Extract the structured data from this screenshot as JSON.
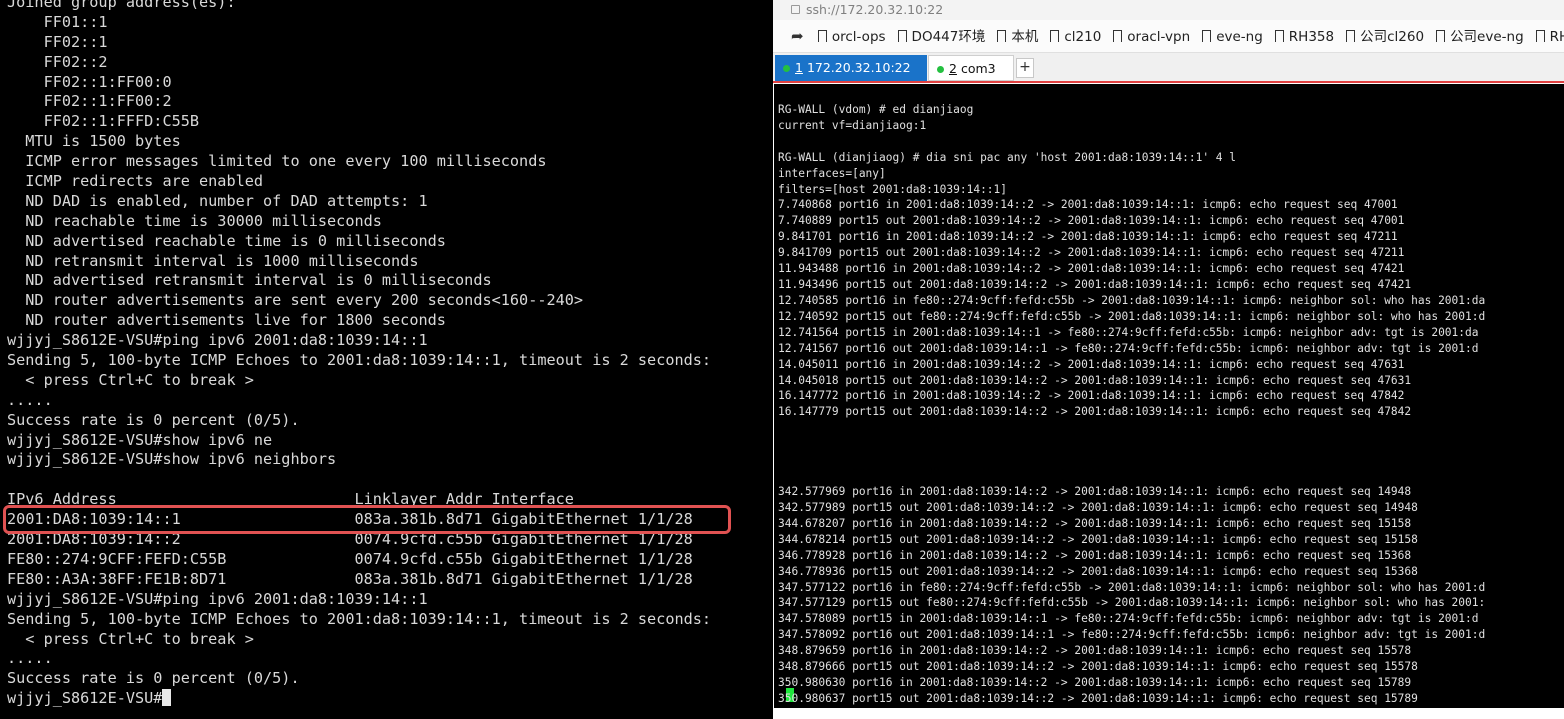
{
  "left_terminal": {
    "lines": [
      "Joined group address(es):",
      "    FF01::1",
      "    FF02::1",
      "    FF02::2",
      "    FF02::1:FF00:0",
      "    FF02::1:FF00:2",
      "    FF02::1:FFFD:C55B",
      "  MTU is 1500 bytes",
      "  ICMP error messages limited to one every 100 milliseconds",
      "  ICMP redirects are enabled",
      "  ND DAD is enabled, number of DAD attempts: 1",
      "  ND reachable time is 30000 milliseconds",
      "  ND advertised reachable time is 0 milliseconds",
      "  ND retransmit interval is 1000 milliseconds",
      "  ND advertised retransmit interval is 0 milliseconds",
      "  ND router advertisements are sent every 200 seconds<160--240>",
      "  ND router advertisements live for 1800 seconds",
      "wjjyj_S8612E-VSU#ping ipv6 2001:da8:1039:14::1",
      "Sending 5, 100-byte ICMP Echoes to 2001:da8:1039:14::1, timeout is 2 seconds:",
      "  < press Ctrl+C to break >",
      ".....",
      "Success rate is 0 percent (0/5).",
      "wjjyj_S8612E-VSU#show ipv6 ne",
      "wjjyj_S8612E-VSU#show ipv6 neighbors",
      "",
      "IPv6 Address                          Linklayer Addr Interface",
      "2001:DA8:1039:14::1                   083a.381b.8d71 GigabitEthernet 1/1/28",
      "2001:DA8:1039:14::2                   0074.9cfd.c55b GigabitEthernet 1/1/28",
      "FE80::274:9CFF:FEFD:C55B              0074.9cfd.c55b GigabitEthernet 1/1/28",
      "FE80::A3A:38FF:FE1B:8D71              083a.381b.8d71 GigabitEthernet 1/1/28",
      "wjjyj_S8612E-VSU#ping ipv6 2001:da8:1039:14::1",
      "Sending 5, 100-byte ICMP Echoes to 2001:da8:1039:14::1, timeout is 2 seconds:",
      "  < press Ctrl+C to break >",
      ".....",
      "Success rate is 0 percent (0/5)."
    ],
    "prompt": "wjjyj_S8612E-VSU#"
  },
  "browser": {
    "url": "ssh://172.20.32.10:22",
    "bookmarks": [
      "orcl-ops",
      "DO447环境",
      "本机",
      "cl210",
      "oracl-vpn",
      "eve-ng",
      "RH358",
      "公司cl260",
      "公司eve-ng",
      "RH"
    ],
    "tabs": [
      {
        "num": "1",
        "label": "172.20.32.10:22",
        "status_color": "#24c040"
      },
      {
        "num": "2",
        "label": "com3",
        "status_color": "#24c040"
      }
    ],
    "add_tab_label": "+"
  },
  "right_terminal": {
    "lines": [
      "",
      "RG-WALL (vdom) # ed dianjiaog",
      "current vf=dianjiaog:1",
      "",
      "RG-WALL (dianjiaog) # dia sni pac any 'host 2001:da8:1039:14::1' 4 l",
      "interfaces=[any]",
      "filters=[host 2001:da8:1039:14::1]",
      "7.740868 port16 in 2001:da8:1039:14::2 -> 2001:da8:1039:14::1: icmp6: echo request seq 47001",
      "7.740889 port15 out 2001:da8:1039:14::2 -> 2001:da8:1039:14::1: icmp6: echo request seq 47001",
      "9.841701 port16 in 2001:da8:1039:14::2 -> 2001:da8:1039:14::1: icmp6: echo request seq 47211",
      "9.841709 port15 out 2001:da8:1039:14::2 -> 2001:da8:1039:14::1: icmp6: echo request seq 47211",
      "11.943488 port16 in 2001:da8:1039:14::2 -> 2001:da8:1039:14::1: icmp6: echo request seq 47421",
      "11.943496 port15 out 2001:da8:1039:14::2 -> 2001:da8:1039:14::1: icmp6: echo request seq 47421",
      "12.740585 port16 in fe80::274:9cff:fefd:c55b -> 2001:da8:1039:14::1: icmp6: neighbor sol: who has 2001:da",
      "12.740592 port15 out fe80::274:9cff:fefd:c55b -> 2001:da8:1039:14::1: icmp6: neighbor sol: who has 2001:d",
      "12.741564 port15 in 2001:da8:1039:14::1 -> fe80::274:9cff:fefd:c55b: icmp6: neighbor adv: tgt is 2001:da",
      "12.741567 port16 out 2001:da8:1039:14::1 -> fe80::274:9cff:fefd:c55b: icmp6: neighbor adv: tgt is 2001:d",
      "14.045011 port16 in 2001:da8:1039:14::2 -> 2001:da8:1039:14::1: icmp6: echo request seq 47631",
      "14.045018 port15 out 2001:da8:1039:14::2 -> 2001:da8:1039:14::1: icmp6: echo request seq 47631",
      "16.147772 port16 in 2001:da8:1039:14::2 -> 2001:da8:1039:14::1: icmp6: echo request seq 47842",
      "16.147779 port15 out 2001:da8:1039:14::2 -> 2001:da8:1039:14::1: icmp6: echo request seq 47842",
      "",
      "",
      "",
      "",
      "342.577969 port16 in 2001:da8:1039:14::2 -> 2001:da8:1039:14::1: icmp6: echo request seq 14948",
      "342.577989 port15 out 2001:da8:1039:14::2 -> 2001:da8:1039:14::1: icmp6: echo request seq 14948",
      "344.678207 port16 in 2001:da8:1039:14::2 -> 2001:da8:1039:14::1: icmp6: echo request seq 15158",
      "344.678214 port15 out 2001:da8:1039:14::2 -> 2001:da8:1039:14::1: icmp6: echo request seq 15158",
      "346.778928 port16 in 2001:da8:1039:14::2 -> 2001:da8:1039:14::1: icmp6: echo request seq 15368",
      "346.778936 port15 out 2001:da8:1039:14::2 -> 2001:da8:1039:14::1: icmp6: echo request seq 15368",
      "347.577122 port16 in fe80::274:9cff:fefd:c55b -> 2001:da8:1039:14::1: icmp6: neighbor sol: who has 2001:d",
      "347.577129 port15 out fe80::274:9cff:fefd:c55b -> 2001:da8:1039:14::1: icmp6: neighbor sol: who has 2001:",
      "347.578089 port15 in 2001:da8:1039:14::1 -> fe80::274:9cff:fefd:c55b: icmp6: neighbor adv: tgt is 2001:d",
      "347.578092 port16 out 2001:da8:1039:14::1 -> fe80::274:9cff:fefd:c55b: icmp6: neighbor adv: tgt is 2001:d",
      "348.879659 port16 in 2001:da8:1039:14::2 -> 2001:da8:1039:14::1: icmp6: echo request seq 15578",
      "348.879666 port15 out 2001:da8:1039:14::2 -> 2001:da8:1039:14::1: icmp6: echo request seq 15578",
      "350.980630 port16 in 2001:da8:1039:14::2 -> 2001:da8:1039:14::1: icmp6: echo request seq 15789",
      "350.980637 port15 out 2001:da8:1039:14::2 -> 2001:da8:1039:14::1: icmp6: echo request seq 15789"
    ]
  }
}
